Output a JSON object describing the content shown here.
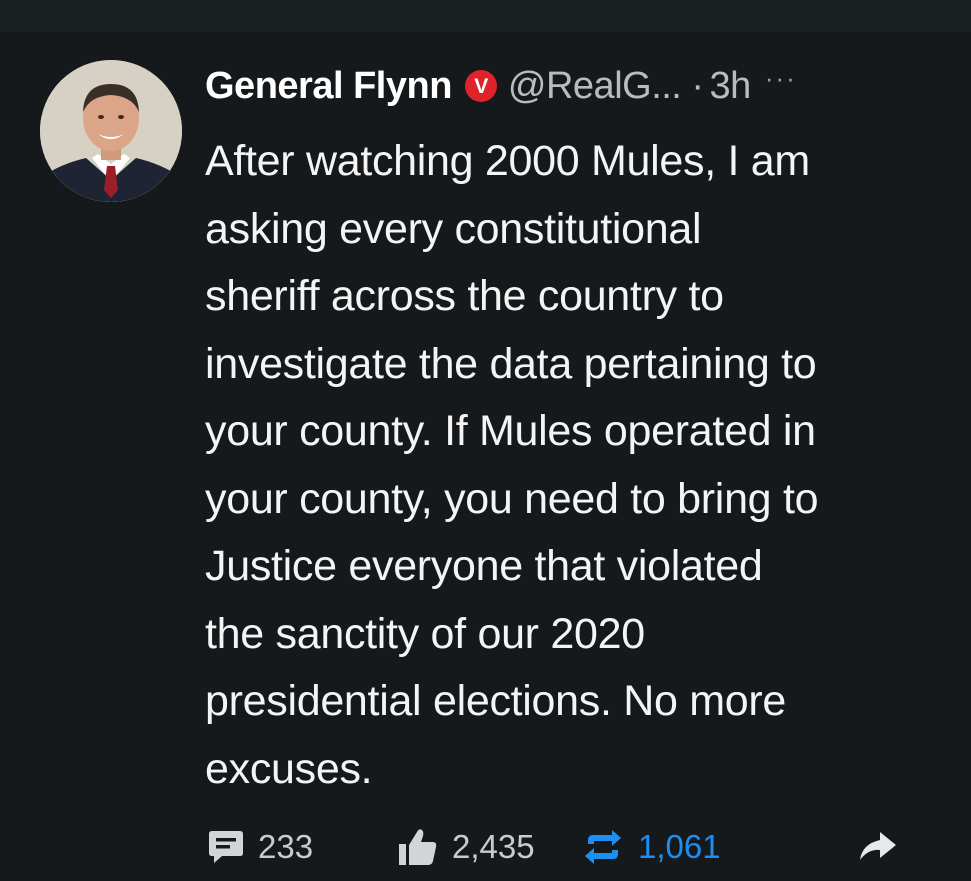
{
  "post": {
    "author": {
      "display_name": "General Flynn",
      "handle": "@RealG...",
      "verified": true,
      "verified_badge_letter": "V",
      "verified_color": "#e0222a"
    },
    "separator": "·",
    "time": "3h",
    "more_label": "···",
    "body_lines": [
      "After watching 2000 Mules, I am",
      "asking every constitutional",
      "sheriff across the country to",
      "investigate the data pertaining to",
      "your county. If Mules operated in",
      "your county, you need to bring to",
      "Justice everyone that violated",
      "the sanctity of our 2020",
      "presidential elections. No more",
      "excuses."
    ],
    "actions": {
      "comments": {
        "icon": "comment-icon",
        "count": "233"
      },
      "likes": {
        "icon": "thumbs-up-icon",
        "count": "2,435"
      },
      "reposts": {
        "icon": "repost-icon",
        "count": "1,061",
        "color": "#1d8ff0"
      },
      "share": {
        "icon": "share-arrow-icon"
      }
    }
  }
}
